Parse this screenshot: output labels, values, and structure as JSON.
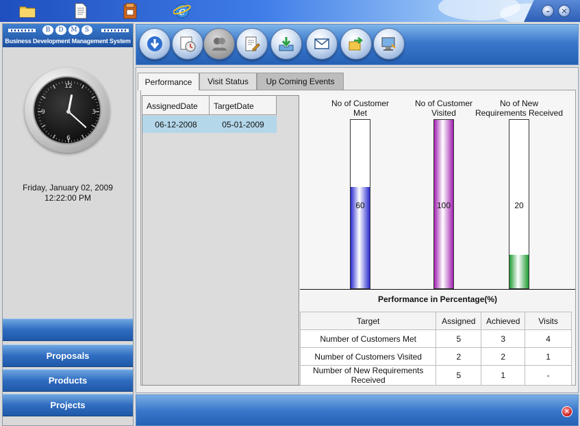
{
  "desktop": {
    "icons": [
      "folder-icon",
      "document-icon",
      "archive-icon",
      "internet-explorer-icon"
    ]
  },
  "window": {
    "minimize_label": "–",
    "close_label": "✕"
  },
  "brand": {
    "letters": [
      "B",
      "D",
      "M",
      "S"
    ],
    "subtitle": "Business Development Management System"
  },
  "clock": {
    "numerals": {
      "twelve": "12",
      "three": "3",
      "six": "6",
      "nine": "9"
    },
    "hour": 12,
    "minute": 22
  },
  "datetime": {
    "date": "Friday, January 02, 2009",
    "time": "12:22:00 PM"
  },
  "left_nav": {
    "items": [
      {
        "label": ""
      },
      {
        "label": "Proposals"
      },
      {
        "label": "Products"
      },
      {
        "label": "Projects"
      }
    ]
  },
  "toolbar": {
    "buttons": [
      {
        "icon": "download-icon",
        "enabled": true
      },
      {
        "icon": "schedule-icon",
        "enabled": true
      },
      {
        "icon": "users-icon",
        "enabled": false
      },
      {
        "icon": "document-edit-icon",
        "enabled": true
      },
      {
        "icon": "download-tray-icon",
        "enabled": true
      },
      {
        "icon": "mail-icon",
        "enabled": true
      },
      {
        "icon": "transfer-icon",
        "enabled": true
      },
      {
        "icon": "computer-icon",
        "enabled": true
      }
    ]
  },
  "tabs": [
    {
      "label": "Performance"
    },
    {
      "label": "Visit Status"
    },
    {
      "label": "Up Coming Events"
    }
  ],
  "dates_table": {
    "headers": [
      "AssignedDate",
      "TargetDate"
    ],
    "rows": [
      [
        "06-12-2008",
        "05-01-2009"
      ]
    ]
  },
  "chart_data": {
    "type": "bar",
    "categories": [
      "No of Customer Met",
      "No of Customer Visited",
      "No of New Requirements Received"
    ],
    "values": [
      60,
      100,
      20
    ],
    "ylim": [
      0,
      100
    ],
    "colors": [
      "#2a2ad0",
      "#a020b0",
      "#1f9a30"
    ],
    "title": "",
    "label_lines": [
      [
        "No of Customer",
        "Met"
      ],
      [
        "No of Customer",
        "Visited"
      ],
      [
        "No of New",
        "Requirements Received"
      ]
    ]
  },
  "performance": {
    "title": "Performance in Percentage(%)",
    "headers": [
      "Target",
      "Assigned",
      "Achieved",
      "Visits"
    ],
    "rows": [
      [
        "Number of Customers Met",
        "5",
        "3",
        "4"
      ],
      [
        "Number of Customers Visited",
        "2",
        "2",
        "1"
      ],
      [
        "Number of New Requirements Received",
        "5",
        "1",
        "-"
      ]
    ]
  },
  "statusbar": {
    "close_label": "✕"
  }
}
